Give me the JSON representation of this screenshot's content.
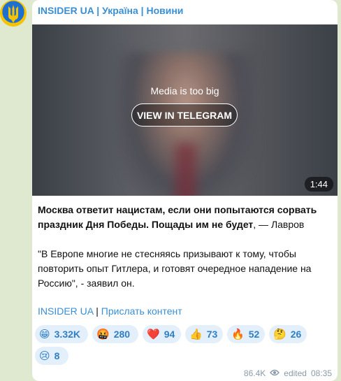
{
  "channel": {
    "name": "INSIDER UA | Україна | Новини"
  },
  "media": {
    "notice": "Media is too big",
    "button_label": "VIEW IN TELEGRAM",
    "duration": "1:44"
  },
  "post": {
    "headline_bold": "Москва ответит нацистам, если они попытаются сорвать праздник Дня Победы. Пощады им не будет",
    "headline_tail": ", — Лавров",
    "quote": "\"В Европе многие не стесняясь призывают к тому, чтобы повторить опыт Гитлера, и готовят очередное нападение на Россию\", - заявил он.",
    "link_channel": "INSIDER UA",
    "link_separator": " | ",
    "link_submit": "Прислать контент"
  },
  "reactions": [
    {
      "emoji": "😁",
      "count": "3.32K"
    },
    {
      "emoji": "🤬",
      "count": "280"
    },
    {
      "emoji": "❤️",
      "count": "94"
    },
    {
      "emoji": "👍",
      "count": "73"
    },
    {
      "emoji": "🔥",
      "count": "52"
    },
    {
      "emoji": "🤔",
      "count": "26"
    },
    {
      "emoji": "😢",
      "count": "8"
    }
  ],
  "meta": {
    "views": "86.4K",
    "edited_label": "edited",
    "time": "08:35"
  },
  "colors": {
    "accent": "#3a8fd4",
    "background": "#dfe9cf",
    "reaction_bg": "#e3effa"
  }
}
